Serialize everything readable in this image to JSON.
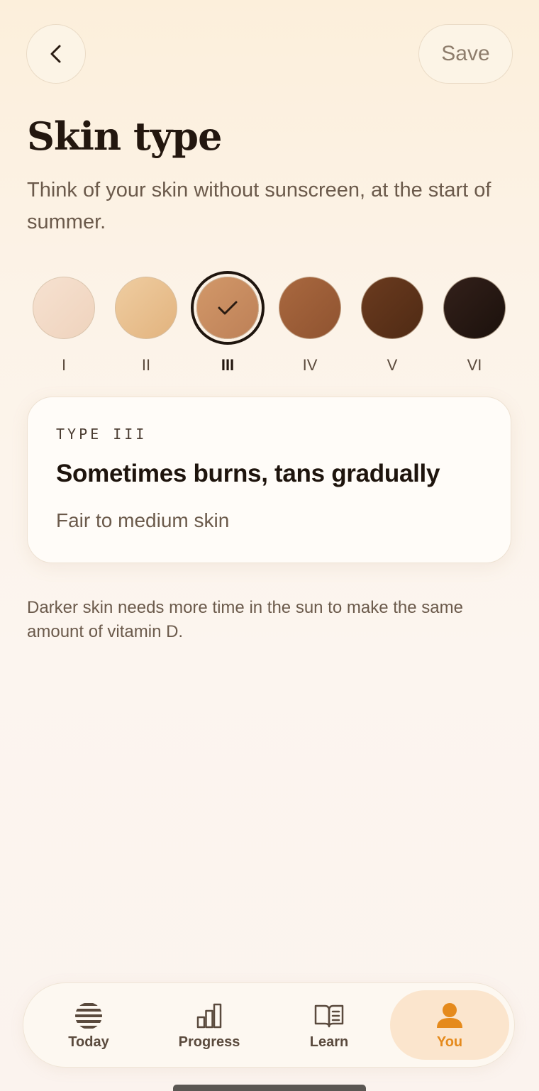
{
  "header": {
    "back_icon": "chevron-left-icon",
    "save_label": "Save",
    "title": "Skin type",
    "subtitle": "Think of your skin without sunscreen, at the start of summer."
  },
  "skin_types": [
    {
      "label": "I",
      "color_start": "#f6e1d0",
      "color_end": "#efd3bd",
      "selected": false
    },
    {
      "label": "II",
      "color_start": "#efcda1",
      "color_end": "#e2b37e",
      "selected": false
    },
    {
      "label": "III",
      "color_start": "#d29869",
      "color_end": "#bd8057",
      "selected": true
    },
    {
      "label": "IV",
      "color_start": "#a9683f",
      "color_end": "#8f5330",
      "selected": false
    },
    {
      "label": "V",
      "color_start": "#6b3b1f",
      "color_end": "#4f2a14",
      "selected": false
    },
    {
      "label": "VI",
      "color_start": "#33201a",
      "color_end": "#1b110c",
      "selected": false
    }
  ],
  "selected_card": {
    "eyebrow": "TYPE III",
    "title": "Sometimes burns, tans gradually",
    "description": "Fair to medium skin"
  },
  "note": "Darker skin needs more time in the sun to make the same amount of vitamin D.",
  "tabbar": {
    "tabs": [
      {
        "label": "Today",
        "icon": "sun-stripes-icon",
        "active": false
      },
      {
        "label": "Progress",
        "icon": "bar-chart-icon",
        "active": false
      },
      {
        "label": "Learn",
        "icon": "book-icon",
        "active": false
      },
      {
        "label": "You",
        "icon": "person-icon",
        "active": true
      }
    ]
  },
  "colors": {
    "accent": "#e58a1c",
    "active_tab_bg": "#fbe5cd"
  }
}
